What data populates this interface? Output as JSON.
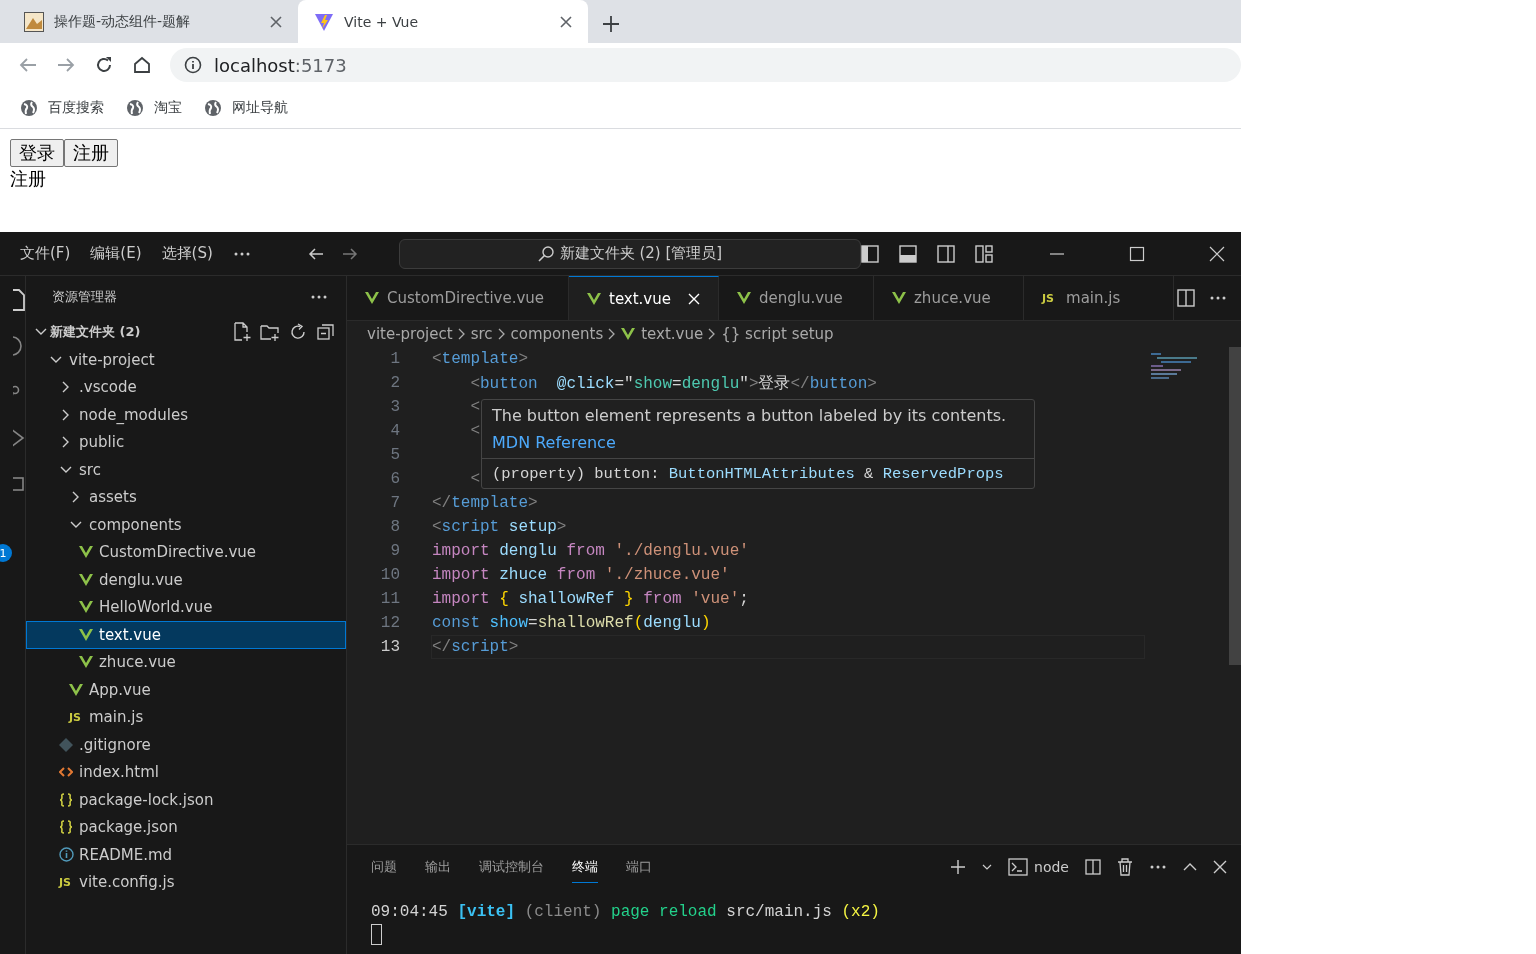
{
  "browser": {
    "tabs": [
      {
        "title": "操作题-动态组件-题解",
        "kind": "image",
        "selected": false
      },
      {
        "title": "Vite + Vue",
        "kind": "vite",
        "selected": true
      }
    ],
    "address": {
      "host": "localhost",
      "port": ":5173"
    },
    "bookmarks": [
      "百度搜索",
      "淘宝",
      "网址导航"
    ],
    "page": {
      "buttons": [
        "登录",
        "注册"
      ],
      "content": "注册"
    }
  },
  "vscode": {
    "menu": [
      "文件(F)",
      "编辑(E)",
      "选择(S)"
    ],
    "command_center": "新建文件夹 (2) [管理员]",
    "activity_badge": "1",
    "sidebar": {
      "title": "资源管理器",
      "root": "新建文件夹 (2)",
      "tree": [
        {
          "label": "vite-project",
          "kind": "folder",
          "expanded": true,
          "selected": false,
          "children": [
            {
              "label": ".vscode",
              "kind": "folder",
              "expanded": false,
              "selected": false
            },
            {
              "label": "node_modules",
              "kind": "folder",
              "expanded": false,
              "selected": false
            },
            {
              "label": "public",
              "kind": "folder",
              "expanded": false,
              "selected": false
            },
            {
              "label": "src",
              "kind": "folder",
              "expanded": true,
              "selected": false,
              "children": [
                {
                  "label": "assets",
                  "kind": "folder",
                  "expanded": false,
                  "selected": false
                },
                {
                  "label": "components",
                  "kind": "folder",
                  "expanded": true,
                  "selected": false,
                  "children": [
                    {
                      "label": "CustomDirective.vue",
                      "kind": "vue",
                      "selected": false
                    },
                    {
                      "label": "denglu.vue",
                      "kind": "vue",
                      "selected": false
                    },
                    {
                      "label": "HelloWorld.vue",
                      "kind": "vue",
                      "selected": false
                    },
                    {
                      "label": "text.vue",
                      "kind": "vue",
                      "selected": true
                    },
                    {
                      "label": "zhuce.vue",
                      "kind": "vue",
                      "selected": false
                    }
                  ]
                },
                {
                  "label": "App.vue",
                  "kind": "vue",
                  "selected": false
                },
                {
                  "label": "main.js",
                  "kind": "js",
                  "icon_text": "JS",
                  "selected": false
                }
              ]
            },
            {
              "label": ".gitignore",
              "kind": "git",
              "selected": false
            },
            {
              "label": "index.html",
              "kind": "html",
              "selected": false
            },
            {
              "label": "package-lock.json",
              "kind": "json",
              "selected": false
            },
            {
              "label": "package.json",
              "kind": "json",
              "selected": false
            },
            {
              "label": "README.md",
              "kind": "info",
              "selected": false
            },
            {
              "label": "vite.config.js",
              "kind": "js",
              "icon_text": "JS",
              "selected": false
            }
          ]
        }
      ]
    },
    "tabs": [
      {
        "label": "CustomDirective.vue",
        "kind": "vue",
        "selected": false
      },
      {
        "label": "text.vue",
        "kind": "vue",
        "selected": true
      },
      {
        "label": "denglu.vue",
        "kind": "vue",
        "selected": false
      },
      {
        "label": "zhuce.vue",
        "kind": "vue",
        "selected": false
      },
      {
        "label": "main.js",
        "kind": "js",
        "icon_text": "JS",
        "selected": false
      }
    ],
    "breadcrumb": [
      {
        "label": "vite-project",
        "kind": "text"
      },
      {
        "label": "src",
        "kind": "text"
      },
      {
        "label": "components",
        "kind": "text"
      },
      {
        "label": "text.vue",
        "kind": "vue"
      },
      {
        "label": "{} script setup",
        "kind": "text"
      }
    ],
    "code": [
      {
        "number": "1",
        "current": false,
        "tokens": [
          {
            "t": "<",
            "kind": "punct"
          },
          {
            "t": "template",
            "kind": "tag"
          },
          {
            "t": ">",
            "kind": "punct"
          }
        ]
      },
      {
        "number": "2",
        "current": false,
        "tokens": [
          {
            "t": "    <",
            "kind": "punct"
          },
          {
            "t": "button",
            "kind": "tag"
          },
          {
            "t": "  @click",
            "kind": "attr"
          },
          {
            "t": "=\"",
            "kind": "plain"
          },
          {
            "t": "show",
            "kind": "expr"
          },
          {
            "t": "=",
            "kind": "plain"
          },
          {
            "t": "denglu",
            "kind": "expr"
          },
          {
            "t": "\"",
            "kind": "plain"
          },
          {
            "t": ">",
            "kind": "punct"
          },
          {
            "t": "登录",
            "kind": "plain"
          },
          {
            "t": "</",
            "kind": "punct"
          },
          {
            "t": "button",
            "kind": "tag"
          },
          {
            "t": ">",
            "kind": "punct"
          }
        ]
      },
      {
        "number": "3",
        "current": false,
        "tokens": [
          {
            "t": "    <",
            "kind": "punct"
          }
        ]
      },
      {
        "number": "4",
        "current": false,
        "tokens": [
          {
            "t": "    <",
            "kind": "punct"
          }
        ]
      },
      {
        "number": "5",
        "current": false
      },
      {
        "number": "6",
        "current": false,
        "tokens": [
          {
            "t": "    <",
            "kind": "punct"
          }
        ]
      },
      {
        "number": "7",
        "current": false,
        "tokens": [
          {
            "t": "</",
            "kind": "punct"
          },
          {
            "t": "template",
            "kind": "tag"
          },
          {
            "t": ">",
            "kind": "punct"
          }
        ]
      },
      {
        "number": "8",
        "current": false,
        "tokens": [
          {
            "t": "<",
            "kind": "punct"
          },
          {
            "t": "script",
            "kind": "tag"
          },
          {
            "t": " setup",
            "kind": "attr"
          },
          {
            "t": ">",
            "kind": "punct"
          }
        ]
      },
      {
        "number": "9",
        "current": false,
        "tokens": [
          {
            "t": "import",
            "kind": "keyword"
          },
          {
            "t": " denglu ",
            "kind": "var"
          },
          {
            "t": "from",
            "kind": "keyword"
          },
          {
            "t": " './denglu.vue'",
            "kind": "string"
          }
        ]
      },
      {
        "number": "10",
        "current": false,
        "tokens": [
          {
            "t": "import",
            "kind": "keyword"
          },
          {
            "t": " zhuce ",
            "kind": "var"
          },
          {
            "t": "from",
            "kind": "keyword"
          },
          {
            "t": " './zhuce.vue'",
            "kind": "string"
          }
        ]
      },
      {
        "number": "11",
        "current": false,
        "tokens": [
          {
            "t": "import",
            "kind": "keyword"
          },
          {
            "t": " {",
            "kind": "brace"
          },
          {
            "t": " shallowRef ",
            "kind": "var"
          },
          {
            "t": "}",
            "kind": "brace"
          },
          {
            "t": " from",
            "kind": "keyword"
          },
          {
            "t": " 'vue'",
            "kind": "string"
          },
          {
            "t": ";",
            "kind": "plain"
          }
        ]
      },
      {
        "number": "12",
        "current": false,
        "tokens": [
          {
            "t": "const",
            "kind": "tag"
          },
          {
            "t": " show",
            "kind": "const"
          },
          {
            "t": "=",
            "kind": "plain"
          },
          {
            "t": "shallowRef",
            "kind": "func"
          },
          {
            "t": "(",
            "kind": "brace"
          },
          {
            "t": "denglu",
            "kind": "var"
          },
          {
            "t": ")",
            "kind": "brace"
          }
        ]
      },
      {
        "number": "13",
        "current": true,
        "tokens": [
          {
            "t": "</",
            "kind": "punct"
          },
          {
            "t": "script",
            "kind": "tag"
          },
          {
            "t": ">",
            "kind": "punct"
          }
        ]
      }
    ],
    "hover": {
      "description": "The button element represents a button labeled by its contents.",
      "link": "MDN Reference",
      "signature": [
        {
          "t": "(property) button: ",
          "kind": "plain"
        },
        {
          "t": "ButtonHTMLAttributes",
          "kind": "type"
        },
        {
          "t": " & ",
          "kind": "plain"
        },
        {
          "t": "ReservedProps",
          "kind": "type"
        }
      ]
    },
    "panel": {
      "tabs": [
        {
          "label": "问题",
          "selected": false
        },
        {
          "label": "输出",
          "selected": false
        },
        {
          "label": "调试控制台",
          "selected": false
        },
        {
          "label": "终端",
          "selected": true
        },
        {
          "label": "端口",
          "selected": false
        }
      ],
      "shell": "node",
      "terminal": [
        {
          "t": "09:04:45 ",
          "kind": "plain"
        },
        {
          "t": "[vite]",
          "kind": "vite"
        },
        {
          "t": " (client)",
          "kind": "dim"
        },
        {
          "t": " page reload",
          "kind": "green"
        },
        {
          "t": " src/main.js",
          "kind": "plain"
        },
        {
          "t": " (x2)",
          "kind": "yellow"
        }
      ]
    }
  }
}
